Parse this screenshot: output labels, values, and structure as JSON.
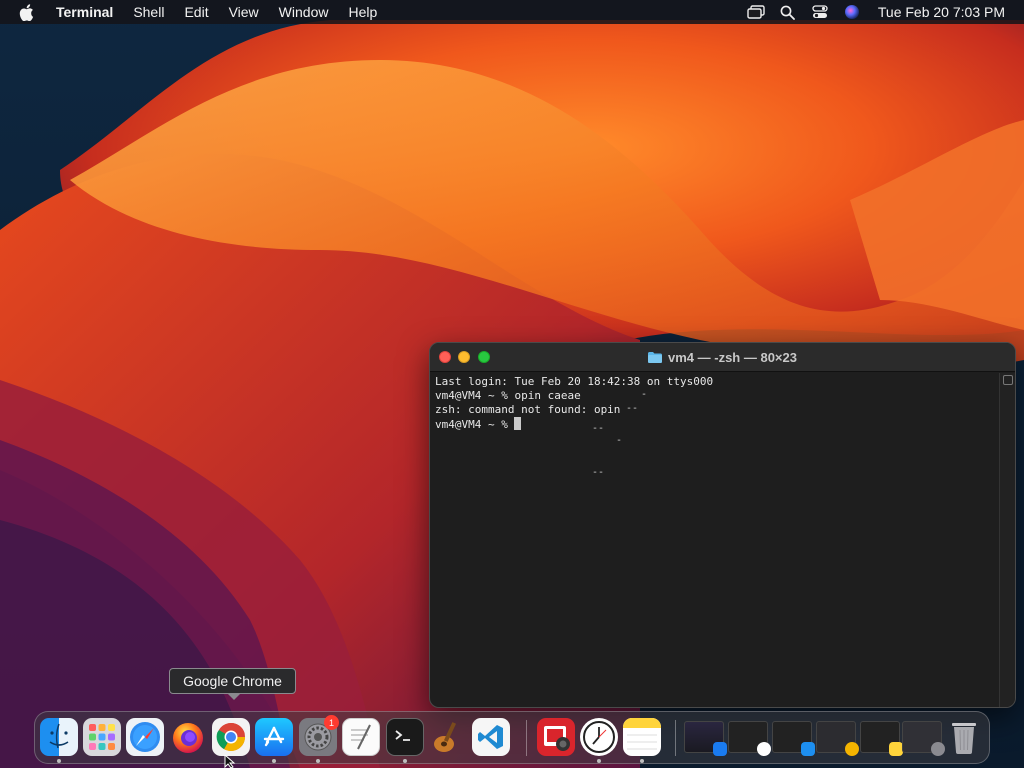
{
  "menubar": {
    "app_name": "Terminal",
    "menus": [
      "Shell",
      "Edit",
      "View",
      "Window",
      "Help"
    ],
    "clock": "Tue Feb 20  7:03 PM",
    "status_icons": [
      "screen-mirroring-icon",
      "search-icon",
      "control-center-icon",
      "siri-icon"
    ]
  },
  "terminal": {
    "title": "vm4 — -zsh — 80×23",
    "lines": [
      "Last login: Tue Feb 20 18:42:38 on ttys000",
      "vm4@VM4 ~ % opin caeae",
      "zsh: command not found: opin",
      "vm4@VM4 ~ % "
    ]
  },
  "tooltip": {
    "text": "Google Chrome"
  },
  "dock": {
    "apps": [
      {
        "name": "Finder",
        "icon": "finder-icon",
        "running": true
      },
      {
        "name": "Launchpad",
        "icon": "launchpad-icon",
        "running": false
      },
      {
        "name": "Safari",
        "icon": "safari-icon",
        "running": false
      },
      {
        "name": "Firefox",
        "icon": "firefox-icon",
        "running": false
      },
      {
        "name": "Google Chrome",
        "icon": "chrome-icon",
        "running": false
      },
      {
        "name": "App Store",
        "icon": "app-store-icon",
        "running": true
      },
      {
        "name": "System Settings",
        "icon": "settings-icon",
        "running": true,
        "badge": "1"
      },
      {
        "name": "TextEdit",
        "icon": "textedit-icon",
        "running": false
      },
      {
        "name": "Terminal",
        "icon": "terminal-icon",
        "running": true
      },
      {
        "name": "Instruments",
        "icon": "instruments-icon",
        "running": false
      },
      {
        "name": "Visual Studio Code",
        "icon": "vscode-icon",
        "running": false
      },
      {
        "name": "Photo Booth",
        "icon": "photo-booth-icon",
        "running": false
      },
      {
        "name": "Clock",
        "icon": "clock-icon",
        "running": true
      },
      {
        "name": "Notes",
        "icon": "notes-icon",
        "running": true
      }
    ],
    "minimized": [
      {
        "icon": "minimized-app-store-window-icon"
      },
      {
        "icon": "minimized-clock-window-icon"
      },
      {
        "icon": "minimized-finder-window-icon"
      },
      {
        "icon": "minimized-chrome-window-icon"
      },
      {
        "icon": "minimized-notes-window-icon"
      },
      {
        "icon": "minimized-settings-window-icon"
      }
    ]
  },
  "colors": {
    "terminal_bg": "#1e1e1e",
    "close": "#ff5f57",
    "minimize": "#febc2e",
    "maximize": "#28c840",
    "wallpaper_orange": "#f26b1d",
    "wallpaper_navy": "#0d2236"
  }
}
